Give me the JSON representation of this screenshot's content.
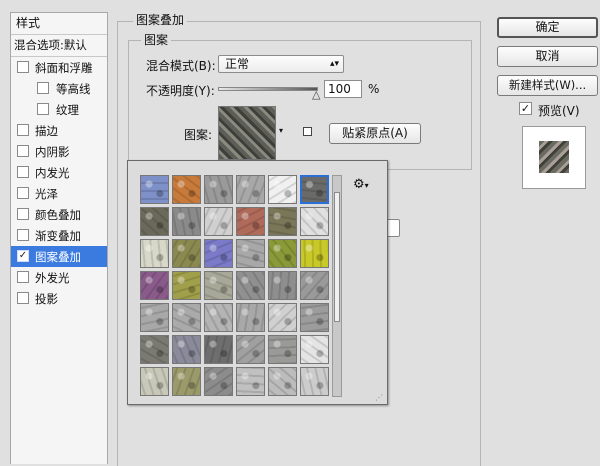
{
  "styles_panel": {
    "header": "样式",
    "blend_options": "混合选项:默认",
    "items": [
      {
        "label": "斜面和浮雕",
        "checked": false,
        "indent": false
      },
      {
        "label": "等高线",
        "checked": false,
        "indent": true
      },
      {
        "label": "纹理",
        "checked": false,
        "indent": true
      },
      {
        "label": "描边",
        "checked": false,
        "indent": false
      },
      {
        "label": "内阴影",
        "checked": false,
        "indent": false
      },
      {
        "label": "内发光",
        "checked": false,
        "indent": false
      },
      {
        "label": "光泽",
        "checked": false,
        "indent": false
      },
      {
        "label": "颜色叠加",
        "checked": false,
        "indent": false
      },
      {
        "label": "渐变叠加",
        "checked": false,
        "indent": false
      },
      {
        "label": "图案叠加",
        "checked": true,
        "indent": false,
        "selected": true
      },
      {
        "label": "外发光",
        "checked": false,
        "indent": false
      },
      {
        "label": "投影",
        "checked": false,
        "indent": false
      }
    ]
  },
  "pattern_overlay": {
    "section_title": "图案叠加",
    "group_title": "图案",
    "blend_mode_label": "混合模式(B):",
    "blend_mode_value": "正常",
    "opacity_label": "不透明度(Y):",
    "opacity_value": "100",
    "opacity_unit": "%",
    "opacity_level": 1.0,
    "pattern_label": "图案:",
    "snap_origin_button": "贴紧原点(A)"
  },
  "picker": {
    "gear_icon": "gear-icon",
    "selected_index": 5,
    "swatch_colors": [
      "#7d90c8",
      "#c87a3a",
      "#9a9a9a",
      "#a8a8a8",
      "#f0f0f0",
      "#6a6a68",
      "#6b6a5a",
      "#8a8a8a",
      "#d0d0d0",
      "#b06a5a",
      "#7a7658",
      "#e0e0e0",
      "#d8d8c8",
      "#8a8a50",
      "#7a7ac8",
      "#a8a8a8",
      "#8a9a38",
      "#c8c828",
      "#8a5a8a",
      "#a0a04a",
      "#a8a898",
      "#909090",
      "#8e8e8e",
      "#9a9a9a",
      "#a8a8a8",
      "#aaaaaa",
      "#b4b4b4",
      "#a8a8a8",
      "#d0d0d0",
      "#9c9c9c",
      "#7a7a72",
      "#8a8a9a",
      "#6e6e6e",
      "#a0a0a0",
      "#9a9a98",
      "#e4e4e4",
      "#c8c8b8",
      "#9a9a6a",
      "#8c8c8c",
      "#c0c0c0",
      "#bcbcbc",
      "#cccccc"
    ]
  },
  "dialog_buttons": {
    "ok": "确定",
    "cancel": "取消",
    "new_style": "新建样式(W)...",
    "preview_label": "预览(V)",
    "preview_checked": true
  }
}
